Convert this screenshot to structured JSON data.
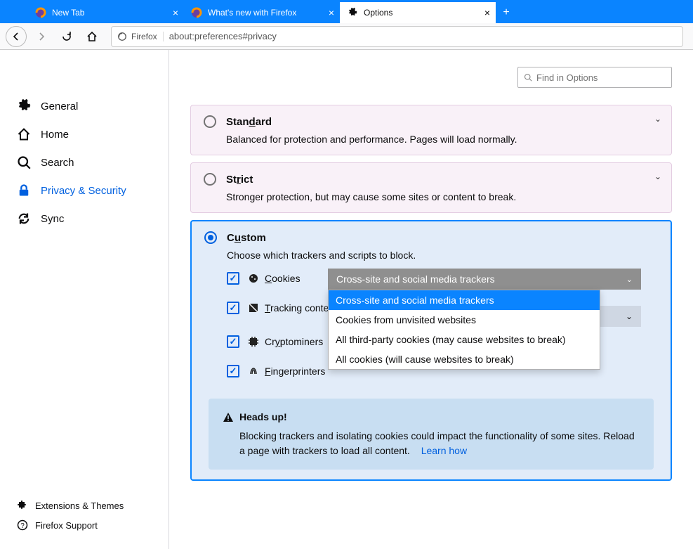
{
  "tabs": [
    {
      "label": "New Tab",
      "active": false
    },
    {
      "label": "What's new with Firefox",
      "active": false
    },
    {
      "label": "Options",
      "active": true
    }
  ],
  "urlbar": {
    "identity": "Firefox",
    "url": "about:preferences#privacy"
  },
  "sidebar": {
    "items": [
      {
        "label": "General"
      },
      {
        "label": "Home"
      },
      {
        "label": "Search"
      },
      {
        "label": "Privacy & Security"
      },
      {
        "label": "Sync"
      }
    ],
    "bottom": [
      {
        "label": "Extensions & Themes"
      },
      {
        "label": "Firefox Support"
      }
    ]
  },
  "search": {
    "placeholder": "Find in Options"
  },
  "protection": {
    "standard": {
      "title": "Standard",
      "desc": "Balanced for protection and performance. Pages will load normally."
    },
    "strict": {
      "title": "Strict",
      "desc": "Stronger protection, but may cause some sites or content to break."
    },
    "custom": {
      "title": "Custom",
      "desc": "Choose which trackers and scripts to block.",
      "cookies_label": "Cookies",
      "tracking_label": "Tracking content",
      "crypto_label": "Cryptominers",
      "finger_label": "Fingerprinters",
      "cookies_select": "Cross-site and social media trackers",
      "cookies_options": [
        "Cross-site and social media trackers",
        "Cookies from unvisited websites",
        "All third-party cookies (may cause websites to break)",
        "All cookies (will cause websites to break)"
      ]
    }
  },
  "alert": {
    "title": "Heads up!",
    "body": "Blocking trackers and isolating cookies could impact the functionality of some sites. Reload a page with trackers to load all content.",
    "link": "Learn how"
  }
}
